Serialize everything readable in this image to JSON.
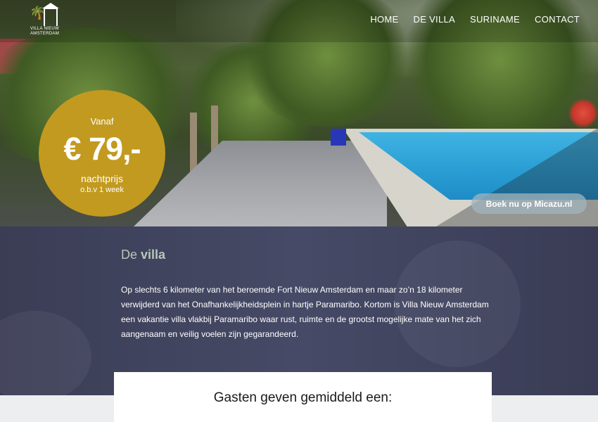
{
  "header": {
    "logo_text": "VILLA NIEUW AMSTERDAM",
    "nav": [
      {
        "label": "HOME"
      },
      {
        "label": "DE VILLA"
      },
      {
        "label": "SURINAME"
      },
      {
        "label": "CONTACT"
      }
    ]
  },
  "hero": {
    "price_badge": {
      "from": "Vanaf",
      "price": "€ 79,-",
      "unit": "nachtprijs",
      "basis": "o.b.v 1 week"
    },
    "book_button": "Boek nu op Micazu.nl"
  },
  "villa": {
    "title_light": "De",
    "title_bold": "villa",
    "description": "Op slechts 6 kilometer van het beroemde Fort Nieuw Amsterdam en maar zo’n 18 kilometer verwijderd van het Onafhankelijkheidsplein in hartje Paramaribo. Kortom is Villa Nieuw Amsterdam een vakantie villa vlakbij Paramaribo waar rust, ruimte en de grootst mogelijke mate van het zich aangenaam en veilig voelen zijn gegarandeerd."
  },
  "reviews": {
    "heading": "Gasten geven gemiddeld een:"
  },
  "colors": {
    "badge": "#c29a1f",
    "villa_bg": "#464a66",
    "villa_title": "#b7c7b9"
  }
}
